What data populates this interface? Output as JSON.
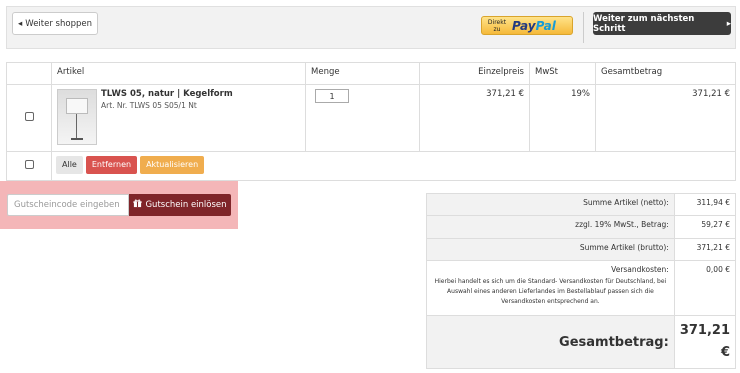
{
  "topbar": {
    "back_label": "Weiter shoppen",
    "paypal_direkt": "Direkt",
    "paypal_zu": "zu",
    "paypal_brand_pay": "Pay",
    "paypal_brand_pal": "Pal",
    "next_label": "Weiter zum nächsten Schritt"
  },
  "cart": {
    "headers": {
      "article": "Artikel",
      "qty": "Menge",
      "unit_price": "Einzelpreis",
      "vat": "MwSt",
      "total": "Gesamtbetrag"
    },
    "items": [
      {
        "name": "TLWS 05, natur | Kegelform",
        "art_nr": "Art. Nr. TLWS 05 S05/1 Nt",
        "qty": "1",
        "unit_price": "371,21 €",
        "vat": "19%",
        "total": "371,21 €"
      }
    ],
    "actions": {
      "all": "Alle",
      "remove": "Entfernen",
      "update": "Aktualisieren"
    }
  },
  "voucher": {
    "placeholder": "Gutscheincode eingeben",
    "button": "Gutschein einlösen"
  },
  "summary": {
    "net_label": "Summe Artikel (netto):",
    "net_value": "311,94 €",
    "vat_label": "zzgl. 19% MwSt., Betrag:",
    "vat_value": "59,27 €",
    "gross_label": "Summe Artikel (brutto):",
    "gross_value": "371,21 €",
    "shipping_label": "Versandkosten:",
    "shipping_value": "0,00 €",
    "shipping_note": "Hierbei handelt es sich um die Standard- Versandkosten für Deutschland, bei Auswahl eines anderen Lieferlandes im Bestellablauf passen sich die Versandkosten entsprechend an.",
    "total_label": "Gesamtbetrag:",
    "total_value_amount": "371,21",
    "total_value_currency": "€"
  },
  "colors": {
    "remove": "#d9534f",
    "update": "#f0ad4e",
    "voucher_button": "#7f2529",
    "voucher_highlight": "#f4b6b8",
    "next_button": "#3c3c3c"
  }
}
